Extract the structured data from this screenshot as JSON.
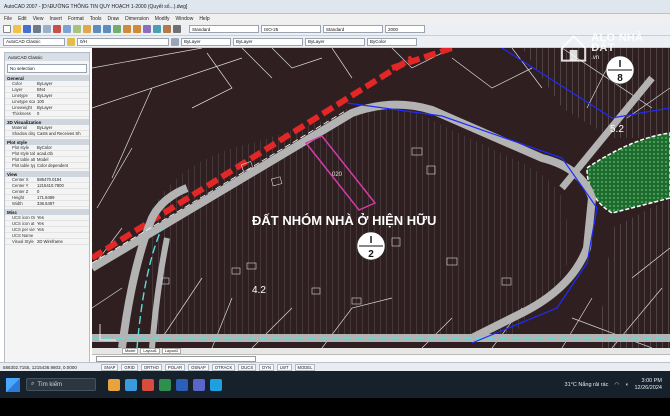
{
  "window": {
    "title": "AutoCAD 2007 - [D:\\ĐƯỜNG THÔNG TIN QUY HOẠCH 1-2000 (Quyết số...).dwg]"
  },
  "menu": [
    "File",
    "Edit",
    "View",
    "Insert",
    "Format",
    "Tools",
    "Draw",
    "Dimension",
    "Modify",
    "Window",
    "Help"
  ],
  "toolbar": {
    "workspace": "AutoCAD Classic",
    "layer": "0/H",
    "color": "ByLayer",
    "linetype": "ByLayer",
    "lineweight": "ByLayer",
    "plotstyle": "ByColor",
    "scale": "2000"
  },
  "palette": {
    "header": "AutoCAD Classic",
    "selection": "No selection",
    "sections": [
      {
        "title": "General",
        "rows": [
          {
            "k": "Color",
            "v": "ByLayer"
          },
          {
            "k": "Layer",
            "v": "BN4"
          },
          {
            "k": "Linetype",
            "v": "ByLayer"
          },
          {
            "k": "Linetype scale",
            "v": "100"
          },
          {
            "k": "Lineweight",
            "v": "ByLayer"
          },
          {
            "k": "Thickness",
            "v": "0"
          }
        ]
      },
      {
        "title": "3D Visualization",
        "rows": [
          {
            "k": "Material",
            "v": "ByLayer"
          },
          {
            "k": "Shadow display",
            "v": "Casts and Receives Sh"
          }
        ]
      },
      {
        "title": "Plot style",
        "rows": [
          {
            "k": "Plot style",
            "v": "ByColor"
          },
          {
            "k": "Plot style table",
            "v": "acad.ctb"
          },
          {
            "k": "Plot table attac",
            "v": "Model"
          },
          {
            "k": "Plot table type",
            "v": "Color dependent"
          }
        ]
      },
      {
        "title": "View",
        "rows": [
          {
            "k": "Center X",
            "v": "586470.0194"
          },
          {
            "k": "Center Y",
            "v": "1215410.7800"
          },
          {
            "k": "Center Z",
            "v": "0"
          },
          {
            "k": "Height",
            "v": "171.8499"
          },
          {
            "k": "Width",
            "v": "336.5497"
          }
        ]
      },
      {
        "title": "Misc",
        "rows": [
          {
            "k": "UCS icon On",
            "v": "Yes"
          },
          {
            "k": "UCS icon at or",
            "v": "Yes"
          },
          {
            "k": "UCS per viewp",
            "v": "Yes"
          },
          {
            "k": "UCS Name",
            "v": ""
          },
          {
            "k": "Visual Style",
            "v": "2D Wireframe"
          }
        ]
      }
    ]
  },
  "drawing": {
    "main_label": "ĐẤT NHÓM NHÀ Ở HIỆN HỮU",
    "center_top": "I",
    "center_bottom": "2",
    "top_right_top": "I",
    "top_right_bottom": "8",
    "left_area": "4.2",
    "right_area": "5.2",
    "dim_label": "020"
  },
  "tabs": [
    "Model",
    "Layout1",
    "Layout2"
  ],
  "status": {
    "coords": "586302.7155, 1215436.9803, 0.0000",
    "toggles": [
      "SNAP",
      "GRID",
      "ORTHO",
      "POLAR",
      "OSNAP",
      "OTRACK",
      "DUCS",
      "DYN",
      "LWT",
      "MODEL"
    ]
  },
  "taskbar": {
    "search": "Tìm kiếm",
    "weather": "31°C  Nắng rải rác",
    "time": "3:00 PM",
    "date": "12/26/2024"
  },
  "watermark": {
    "line1": "ALO NHÀ ĐẤT",
    "line2": ".vn"
  },
  "colors": {
    "canvas_bg": "#2f1f21",
    "road": "#b3b3b3",
    "red_line": "#e32727",
    "lot_line": "#ffffff",
    "boundary": "#1e2cff",
    "parcel_highlight": "#d63aa8",
    "park": "#1d6b2e"
  }
}
